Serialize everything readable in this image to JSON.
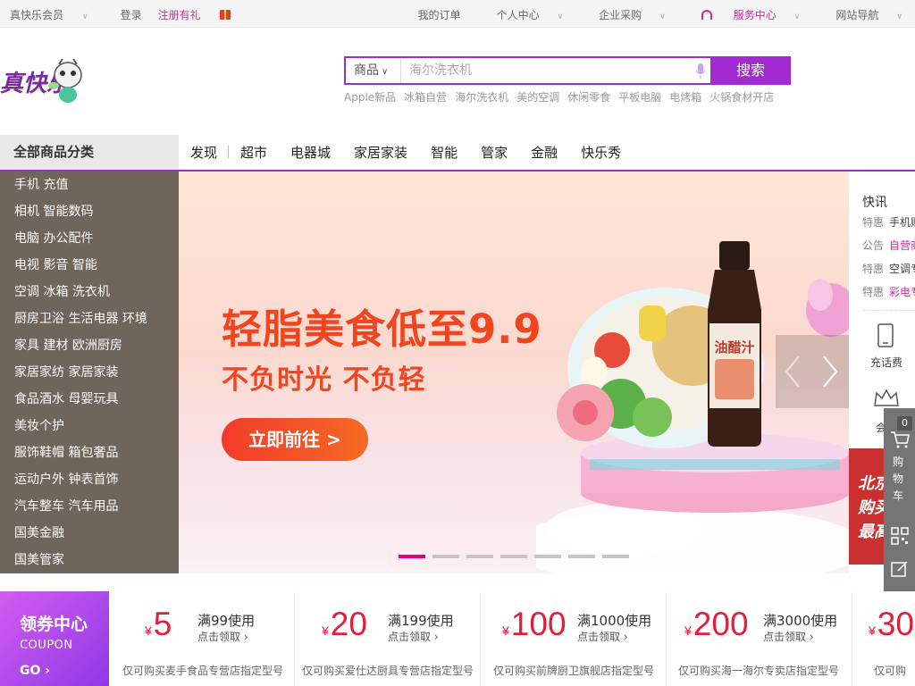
{
  "topbar": {
    "member": "真快乐会员",
    "login": "登录",
    "register": "注册有礼",
    "orders": "我的订单",
    "personal": "个人中心",
    "enterprise": "企业采购",
    "service": "服务中心",
    "sitenav": "网站导航"
  },
  "search": {
    "category": "商品",
    "placeholder": "海尔洗衣机",
    "button": "搜索",
    "hotwords": [
      "Apple新品",
      "冰箱自营",
      "海尔洗衣机",
      "美的空调",
      "休闲零食",
      "平板电脑",
      "电烤箱",
      "火锅食材开店"
    ]
  },
  "nav": {
    "all_categories": "全部商品分类",
    "items": [
      "发现",
      "超市",
      "电器城",
      "家居家装",
      "智能",
      "管家",
      "金融",
      "快乐秀"
    ]
  },
  "sidebar": [
    "手机  充值",
    "相机  智能数码",
    "电脑  办公配件",
    "电视  影音  智能",
    "空调  冰箱  洗衣机",
    "厨房卫浴  生活电器  环境",
    "家具  建材  欧洲厨房",
    "家居家纺  家居家装",
    "食品酒水  母婴玩具",
    "美妆个护",
    "服饰鞋帽  箱包奢品",
    "运动户外  钟表首饰",
    "汽车整车  汽车用品",
    "国美金融",
    "国美管家"
  ],
  "banner": {
    "title": "轻脂美食低至9.9",
    "subtitle": "不负时光 不负轻",
    "cta": "立即前往 >",
    "product_label": "油醋汁",
    "slide_count": 7,
    "active_slide": 0
  },
  "right_panel": {
    "heading": "快讯",
    "news": [
      {
        "tag": "特惠",
        "text": "手机赚"
      },
      {
        "tag": "公告",
        "text": "自营商"
      },
      {
        "tag": "特惠",
        "text": "空调专"
      },
      {
        "tag": "特惠",
        "text": "彩电专"
      }
    ],
    "recharge": "充话费",
    "member_short": "会",
    "promo_lines": [
      "北京",
      "购买",
      "最高"
    ]
  },
  "toolbar": {
    "cart_count": "0",
    "cart_label": "购物车"
  },
  "coupons": {
    "center_title": "领券中心",
    "center_en": "COUPON",
    "center_go": "GO",
    "items": [
      {
        "amount": "5",
        "condition": "满99使用",
        "action": "点击领取",
        "desc": "仅可购买麦手食品专营店指定型号"
      },
      {
        "amount": "20",
        "condition": "满199使用",
        "action": "点击领取",
        "desc": "仅可购买爱仕达厨具专营店指定型号"
      },
      {
        "amount": "100",
        "condition": "满1000使用",
        "action": "点击领取",
        "desc": "仅可购买前牌厨卫旗舰店指定型号"
      },
      {
        "amount": "200",
        "condition": "满3000使用",
        "action": "点击领取",
        "desc": "仅可购买海一海尔专卖店指定型号"
      },
      {
        "amount": "30",
        "condition": "",
        "action": "",
        "desc": "仅可购"
      }
    ]
  },
  "colors": {
    "brand_purple": "#a12ad0",
    "accent_pink": "#cc2ba0",
    "banner_red": "#f0451f",
    "coupon_red": "#e31e3a",
    "sidebar_bg": "#6f655a"
  }
}
